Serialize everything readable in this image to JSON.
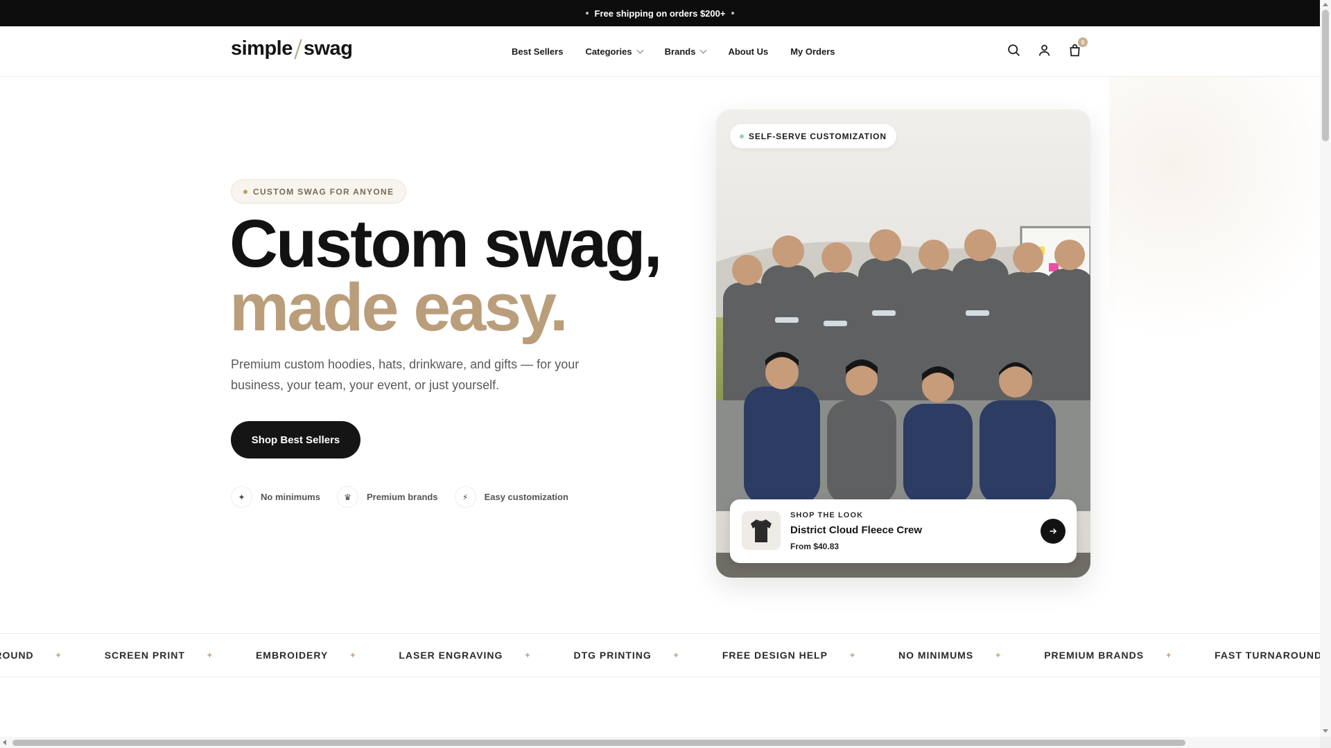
{
  "announcement": {
    "text": "Free shipping on orders $200+"
  },
  "header": {
    "logo_left": "simple",
    "logo_right": "swag",
    "nav": [
      {
        "label": "Best Sellers",
        "dropdown": false
      },
      {
        "label": "Categories",
        "dropdown": true
      },
      {
        "label": "Brands",
        "dropdown": true
      },
      {
        "label": "About Us",
        "dropdown": false
      },
      {
        "label": "My Orders",
        "dropdown": false
      }
    ],
    "icons": [
      "search-icon",
      "user-icon",
      "cart-icon"
    ],
    "cart_count": "0"
  },
  "hero": {
    "eyebrow": "CUSTOM SWAG FOR ANYONE",
    "title_line1": "Custom swag,",
    "title_line2": "made easy.",
    "subtitle": "Premium custom hoodies, hats, drinkware, and gifts — for your business, your team, your event, or just yourself.",
    "cta_label": "Shop Best Sellers",
    "features": [
      {
        "icon": "sparkle-icon",
        "glyph": "✦",
        "label": "No minimums"
      },
      {
        "icon": "crown-icon",
        "glyph": "♛",
        "label": "Premium brands"
      },
      {
        "icon": "bolt-icon",
        "glyph": "⚡",
        "label": "Easy customization"
      }
    ]
  },
  "card": {
    "pill": "SELF-SERVE CUSTOMIZATION",
    "shop_the_look": {
      "tag": "SHOP THE LOOK",
      "product_name": "District Cloud Fleece Crew",
      "price": "From $40.83"
    }
  },
  "marquee": {
    "items": [
      "RNAROUND",
      "SCREEN PRINT",
      "EMBROIDERY",
      "LASER ENGRAVING",
      "DTG PRINTING",
      "FREE DESIGN HELP",
      "NO MINIMUMS",
      "PREMIUM BRANDS",
      "FAST TURNAROUND"
    ],
    "separator": "+"
  },
  "colors": {
    "accent": "#ba9e7b",
    "dark": "#121212",
    "announcement_bg": "#0d0d0d"
  }
}
